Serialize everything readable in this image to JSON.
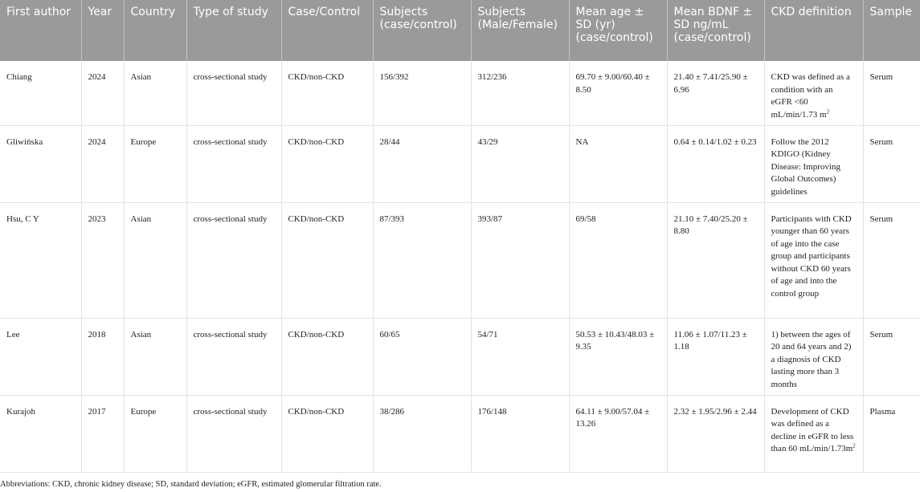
{
  "headers": [
    "First author",
    "Year",
    "Country",
    "Type of study",
    "Case/Control",
    "Subjects (case/control)",
    "Subjects (Male/Female)",
    "Mean age ± SD (yr) (case/control)",
    "Mean BDNF ± SD ng/mL (case/control)",
    "CKD definition",
    "Sample"
  ],
  "rows": [
    {
      "author": "Chiang",
      "year": "2024",
      "country": "Asian",
      "study_type": "cross-sectional study",
      "case_control": "CKD/non-CKD",
      "subjects_cc": "156/392",
      "subjects_mf": "312/236",
      "age": "69.70 ± 9.00/60.40 ± 8.50",
      "bdnf": "21.40 ± 7.41/25.90 ± 6.96",
      "definition": "CKD was defined as a condition with an eGFR <60 mL/min/1.73 m",
      "definition_sup": "2",
      "sample": "Serum"
    },
    {
      "author": "Gliwińska",
      "year": "2024",
      "country": "Europe",
      "study_type": "cross-sectional study",
      "case_control": "CKD/non-CKD",
      "subjects_cc": "28/44",
      "subjects_mf": "43/29",
      "age": "NA",
      "bdnf": "0.64 ± 0.14/1.02 ± 0.23",
      "definition": "Follow the 2012 KDIGO (Kidney Disease: Improving Global Outcomes) guidelines",
      "definition_sup": "",
      "sample": "Serum"
    },
    {
      "author": "Hsu, C Y",
      "year": "2023",
      "country": "Asian",
      "study_type": "cross-sectional study",
      "case_control": "CKD/non-CKD",
      "subjects_cc": "87/393",
      "subjects_mf": "393/87",
      "age": "69/58",
      "bdnf": "21.10 ± 7.40/25.20 ± 8.80",
      "definition": "Participants with CKD younger than 60 years of age into the case group and participants without CKD 60 years of age and into the control group",
      "definition_sup": "",
      "sample": "Serum"
    },
    {
      "author": "Lee",
      "year": "2018",
      "country": "Asian",
      "study_type": "cross-sectional study",
      "case_control": "CKD/non-CKD",
      "subjects_cc": "60/65",
      "subjects_mf": "54/71",
      "age": "50.53 ± 10.43/48.03 ± 9.35",
      "bdnf": "11.06 ± 1.07/11.23 ± 1.18",
      "definition": "1) between the ages of 20 and 64 years and 2) a diagnosis of CKD lasting more than 3 months",
      "definition_sup": "",
      "sample": "Serum"
    },
    {
      "author": "Kurajoh",
      "year": "2017",
      "country": "Europe",
      "study_type": "cross-sectional study",
      "case_control": "CKD/non-CKD",
      "subjects_cc": "38/286",
      "subjects_mf": "176/148",
      "age": "64.11 ± 9.00/57.04 ± 13.26",
      "bdnf": "2.32 ± 1.95/2.96 ± 2.44",
      "definition": "Development of CKD was defined as a decline in eGFR to less than 60 mL/min/1.73m",
      "definition_sup": "2",
      "sample": "Plasma"
    }
  ],
  "footnote": "Abbreviations: CKD, chronic kidney disease; SD, standard deviation; eGFR, estimated glomerular filtration rate."
}
